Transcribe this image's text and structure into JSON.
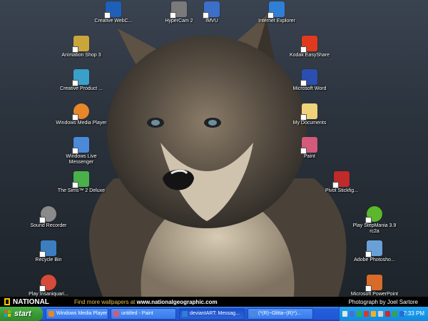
{
  "desktop": {
    "icons": [
      {
        "label": "Creative WebC...",
        "icon": "webcam-icon",
        "color": "#1e5fb8"
      },
      {
        "label": "HyperCam 2",
        "icon": "hypercam-icon",
        "color": "#7a7a7a"
      },
      {
        "label": "IMVU",
        "icon": "imvu-icon",
        "color": "#3b6fc9"
      },
      {
        "label": "Internet Explorer",
        "icon": "internet-explorer-icon",
        "color": "#2f7fd6"
      },
      {
        "label": "Animation Shop 3",
        "icon": "animation-shop-icon",
        "color": "#c9a53a"
      },
      {
        "label": "Kodak EasyShare",
        "icon": "kodak-icon",
        "color": "#e03a1e"
      },
      {
        "label": "Creative Product ...",
        "icon": "creative-product-icon",
        "color": "#3aa0c9"
      },
      {
        "label": "Microsoft Word",
        "icon": "word-icon",
        "color": "#2b4fb0"
      },
      {
        "label": "Windows Media Player",
        "icon": "media-player-icon",
        "color": "#e8862a"
      },
      {
        "label": "My Documents",
        "icon": "folder-icon",
        "color": "#f0d27a"
      },
      {
        "label": "Paint",
        "icon": "paint-icon",
        "color": "#d35a7a"
      },
      {
        "label": "Windows Live Messenger",
        "icon": "messenger-icon",
        "color": "#4a8ad8"
      },
      {
        "label": "The Sims™ 2 Deluxe",
        "icon": "sims-icon",
        "color": "#4ab14a"
      },
      {
        "label": "Pivot Stickfig...",
        "icon": "stickfigure-icon",
        "color": "#c02a2a"
      },
      {
        "label": "Sound Recorder",
        "icon": "microphone-icon",
        "color": "#8a8a8a"
      },
      {
        "label": "Play StepMania 3.9 rc2a",
        "icon": "stepmania-icon",
        "color": "#5ab82a"
      },
      {
        "label": "Recycle Bin",
        "icon": "recycle-bin-icon",
        "color": "#3c7fc1"
      },
      {
        "label": "Adobe Photosho...",
        "icon": "photoshop-icon",
        "color": "#6aa0d8"
      },
      {
        "label": "Play Insaniquari...",
        "icon": "insaniquarium-icon",
        "color": "#d64a3a"
      },
      {
        "label": "Microsoft PowerPoint",
        "icon": "powerpoint-icon",
        "color": "#d86a2a"
      }
    ]
  },
  "banner": {
    "logo": "NATIONAL",
    "promo_prefix": "Find more wallpapers at",
    "promo_url": "www.nationalgeographic.com",
    "credit": "Photograph by Joel Sartore"
  },
  "taskbar": {
    "start_label": "start",
    "tasks": [
      {
        "label": "Windows Media Player",
        "icon": "media-player-icon",
        "color": "#e8862a"
      },
      {
        "label": "untitled - Paint",
        "icon": "paint-icon",
        "color": "#d35a7a"
      },
      {
        "label": "deviantART: Messag...",
        "icon": "internet-explorer-icon",
        "color": "#2f7fd6"
      },
      {
        "label": "(*(R)~Glitta~(R)*)...",
        "icon": "messenger-icon",
        "color": "#4a8ad8"
      }
    ],
    "tray_icons": [
      "language-icon",
      "network-icon",
      "messenger-tray-icon",
      "antivirus-icon",
      "update-icon",
      "volume-icon",
      "security-icon",
      "messenger-status-icon",
      "media-icon"
    ],
    "clock": "7:33 PM"
  }
}
